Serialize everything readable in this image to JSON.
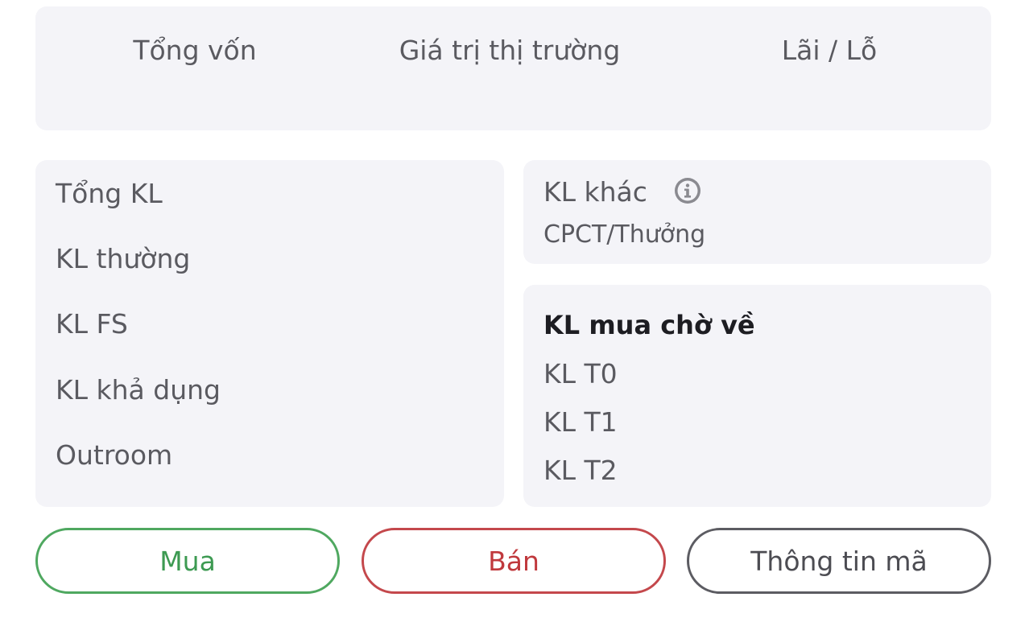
{
  "summary": {
    "capital_label": "Tổng vốn",
    "market_value_label": "Giá trị thị trường",
    "profit_loss_label": "Lãi / Lỗ"
  },
  "holdings": {
    "total_label": "Tổng KL",
    "normal_label": "KL thường",
    "fs_label": "KL FS",
    "available_label": "KL khả dụng",
    "outroom_label": "Outroom"
  },
  "other": {
    "label": "KL khác",
    "sublabel": "CPCT/Thưởng",
    "icon": "info-icon"
  },
  "pending": {
    "title": "KL mua chờ về",
    "t0_label": "KL T0",
    "t1_label": "KL T1",
    "t2_label": "KL T2"
  },
  "actions": {
    "buy_label": "Mua",
    "sell_label": "Bán",
    "info_label": "Thông tin mã"
  },
  "colors": {
    "buy": "#3d9a52",
    "sell": "#c0393d",
    "card_background": "#f4f4f8"
  }
}
